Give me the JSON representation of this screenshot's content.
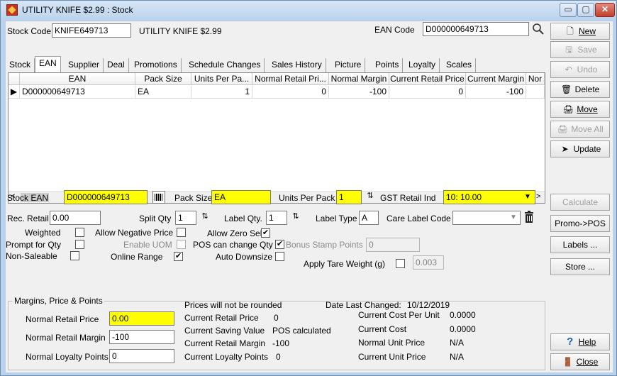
{
  "window": {
    "title": "UTILITY KNIFE $2.99 : Stock",
    "minimize": "▭",
    "maximize": "▢",
    "close": "✕"
  },
  "header": {
    "stock_code_label": "Stock Code",
    "stock_code": "KNIFE649713",
    "description": "UTILITY KNIFE $2.99",
    "ean_label": "EAN Code",
    "ean_code": "D000000649713"
  },
  "tabs": [
    "Stock",
    "EAN",
    "Supplier",
    "Deal",
    "Promotions",
    "Schedule Changes",
    "Sales History",
    "Picture",
    "Points",
    "Loyalty",
    "Scales"
  ],
  "grid": {
    "columns": [
      "EAN",
      "Pack Size",
      "Units Per Pa...",
      "Normal Retail Pri...",
      "Normal Margin",
      "Current Retail Price",
      "Current Margin",
      "Nor"
    ],
    "rows": [
      [
        "D000000649713",
        "EA",
        "1",
        "0",
        "-100",
        "0",
        "-100",
        ""
      ]
    ]
  },
  "ean_detail": {
    "stock_ean_label": "Stock EAN",
    "stock_ean": "D000000649713",
    "pack_size_label": "Pack Size",
    "pack_size": "EA",
    "units_per_pack_label": "Units Per Pack",
    "units_per_pack": "1",
    "gst_label": "GST Retail Ind",
    "gst_value": "10: 10.00",
    "rec_retail_label": "Rec. Retail",
    "rec_retail": "0.00",
    "split_qty_label": "Split Qty",
    "split_qty": "1",
    "label_qty_label": "Label Qty.",
    "label_qty": "1",
    "label_type_label": "Label Type",
    "label_type": "A",
    "care_label_label": "Care Label Code",
    "care_label": "",
    "weighted_label": "Weighted",
    "allow_neg_label": "Allow Negative Price",
    "allow_zero_label": "Allow Zero Sell",
    "prompt_qty_label": "Prompt for Qty",
    "enable_uom_label": "Enable UOM",
    "pos_change_label": "POS can change Qty",
    "bonus_stamp_label": "Bonus Stamp Points",
    "bonus_stamp": "0",
    "non_saleable_label": "Non-Saleable",
    "online_range_label": "Online Range",
    "auto_downsize_label": "Auto Downsize",
    "tare_label": "Apply Tare Weight (g)",
    "tare_value": "0.003",
    "checked_mark": "✔"
  },
  "margins": {
    "group_title": "Margins, Price & Points",
    "normal_retail_price_label": "Normal Retail Price",
    "normal_retail_price": "0.00",
    "normal_retail_margin_label": "Normal Retail Margin",
    "normal_retail_margin": "-100",
    "normal_loyalty_label": "Normal Loyalty Points",
    "normal_loyalty": "0",
    "rounding_note": "Prices will not be rounded",
    "date_changed_label": "Date Last Changed:",
    "date_changed": "10/12/2019",
    "current_retail_price_label": "Current Retail Price",
    "current_retail_price": "0",
    "current_saving_label": "Current Saving Value",
    "current_saving": "POS calculated",
    "current_retail_margin_label": "Current Retail Margin",
    "current_retail_margin": "-100",
    "current_loyalty_label": "Current Loyalty Points",
    "current_loyalty": "0",
    "cost_per_unit_label": "Current Cost Per Unit",
    "cost_per_unit": "0.0000",
    "current_cost_label": "Current Cost",
    "current_cost": "0.0000",
    "normal_unit_price_label": "Normal Unit Price",
    "normal_unit_price": "N/A",
    "current_unit_price_label": "Current Unit Price",
    "current_unit_price": "N/A"
  },
  "buttons": {
    "new": "New",
    "save": "Save",
    "undo": "Undo",
    "delete": "Delete",
    "move": "Move",
    "move_all": "Move All",
    "update": "Update",
    "calculate": "Calculate",
    "promo_pos": "Promo->POS",
    "labels": "Labels ...",
    "store": "Store ...",
    "help": "Help",
    "close": "Close"
  },
  "colors": {
    "highlight": "#ffff00",
    "titlebar": "#bcd3ec"
  }
}
